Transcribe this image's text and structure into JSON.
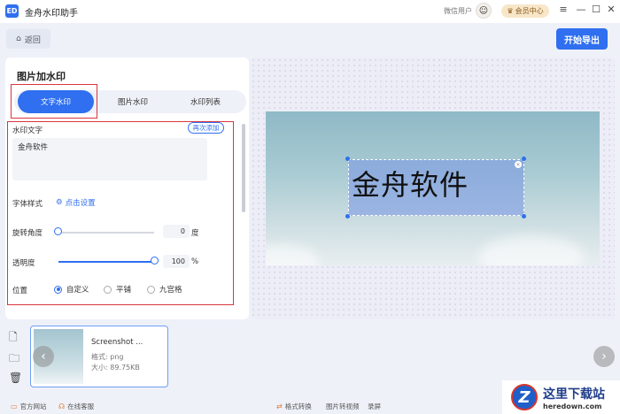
{
  "titlebar": {
    "logo_text": "ED",
    "title": "金舟水印助手",
    "user_label": "微信用户",
    "member_label": "会员中心",
    "minimize": "—",
    "maximize": "☐",
    "close": "✕",
    "menu": "≡"
  },
  "toolbar": {
    "back_label": "返回",
    "export_label": "开始导出"
  },
  "panel": {
    "title": "图片加水印",
    "tabs": [
      {
        "label": "文字水印",
        "active": true
      },
      {
        "label": "图片水印",
        "active": false
      },
      {
        "label": "水印列表",
        "active": false
      }
    ],
    "watermark_text_label": "水印文字",
    "readd_label": "再次添加",
    "watermark_text_value": "金舟软件",
    "font_style_label": "字体样式",
    "font_setting_link": "点击设置",
    "rotation_label": "旋转角度",
    "rotation_value": "0",
    "rotation_unit": "度",
    "opacity_label": "透明度",
    "opacity_value": "100",
    "opacity_unit": "%",
    "position_label": "位置",
    "position_options": [
      {
        "label": "自定义",
        "selected": true
      },
      {
        "label": "平铺",
        "selected": false
      },
      {
        "label": "九宫格",
        "selected": false
      }
    ]
  },
  "preview": {
    "watermark_text": "金舟软件"
  },
  "thumbnail": {
    "name": "Screenshot ...",
    "format": "格式: png",
    "size": "大小: 89.75KB"
  },
  "footer": {
    "website": "官方网站",
    "support": "在线客服",
    "format_convert": "格式转换",
    "image_to_video": "图片转视频",
    "record": "录屏"
  },
  "site_logo": {
    "cn": "这里下载站",
    "en": "heredown.com",
    "mark": "Z"
  },
  "colors": {
    "accent": "#2f6ff0",
    "highlight_box": "#d9363e"
  }
}
